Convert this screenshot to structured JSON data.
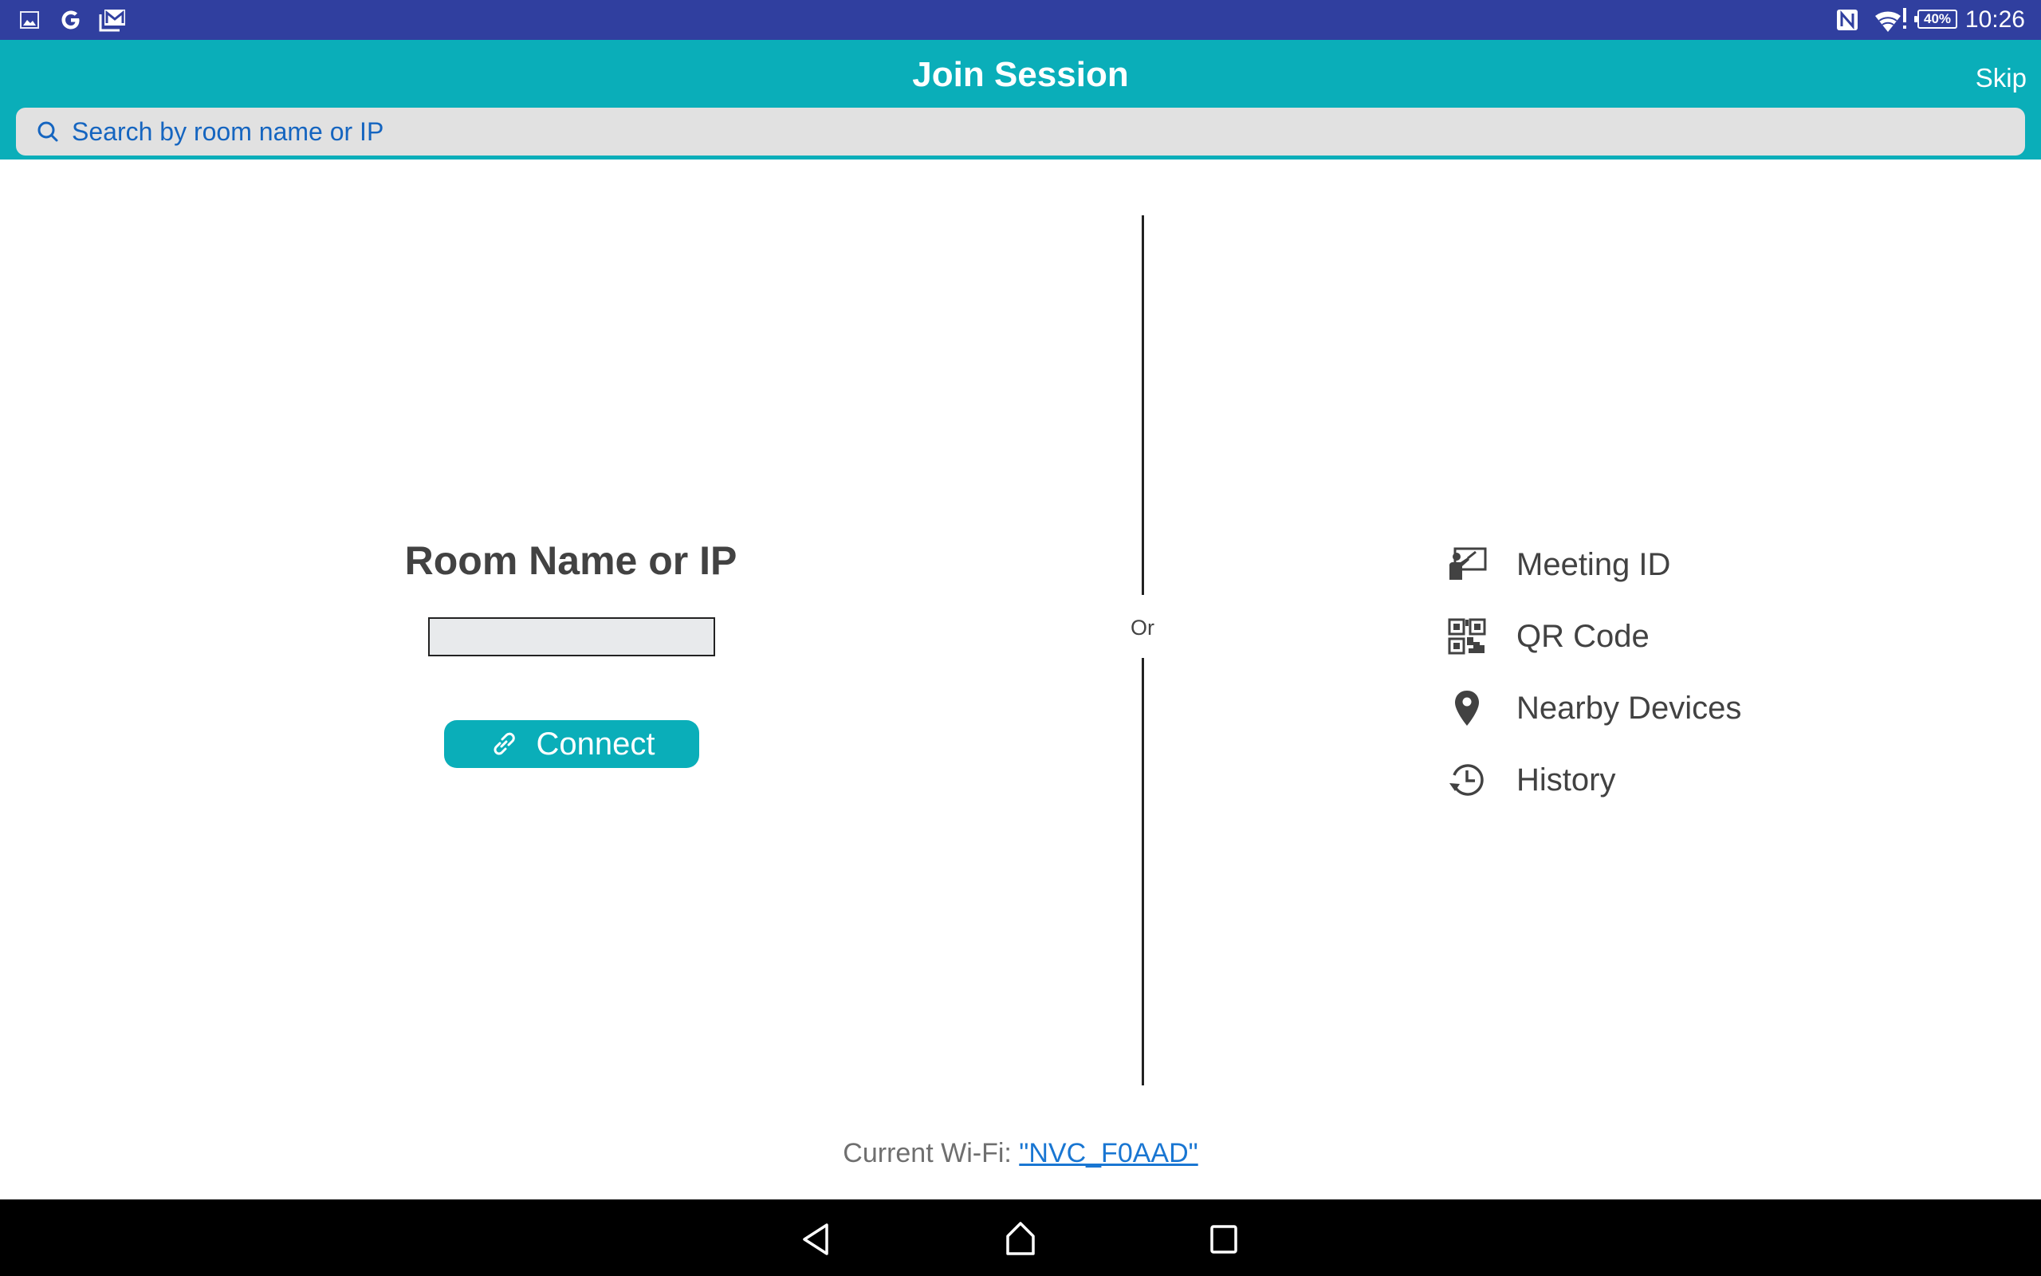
{
  "status_bar": {
    "left_icons": [
      "gallery-icon",
      "google-icon",
      "gmail-icon"
    ],
    "right_icons": [
      "nfc-icon",
      "wifi-warning-icon",
      "battery-icon"
    ],
    "battery": "40%",
    "time": "10:26"
  },
  "header": {
    "title": "Join Session",
    "skip_label": "Skip",
    "search_placeholder": "Search by room name or IP",
    "search_value": ""
  },
  "manual_connect": {
    "title": "Room Name or IP",
    "input_value": "",
    "connect_label": "Connect",
    "connect_icon": "link-icon"
  },
  "separator_label": "Or",
  "options": [
    {
      "label": "Meeting ID",
      "icon": "presenter-icon"
    },
    {
      "label": "QR Code",
      "icon": "qr-code-icon"
    },
    {
      "label": "Nearby Devices",
      "icon": "location-pin-icon"
    },
    {
      "label": "History",
      "icon": "history-icon"
    }
  ],
  "footer": {
    "wifi_label": "Current Wi-Fi: ",
    "wifi_name": "\"NVC_F0AAD\""
  },
  "colors": {
    "status_bar": "#303f9f",
    "accent": "#0aaeb9",
    "link": "#1976d2",
    "search_text": "#1565c0"
  },
  "nav_bar": {
    "buttons": [
      "back",
      "home",
      "recents"
    ]
  }
}
